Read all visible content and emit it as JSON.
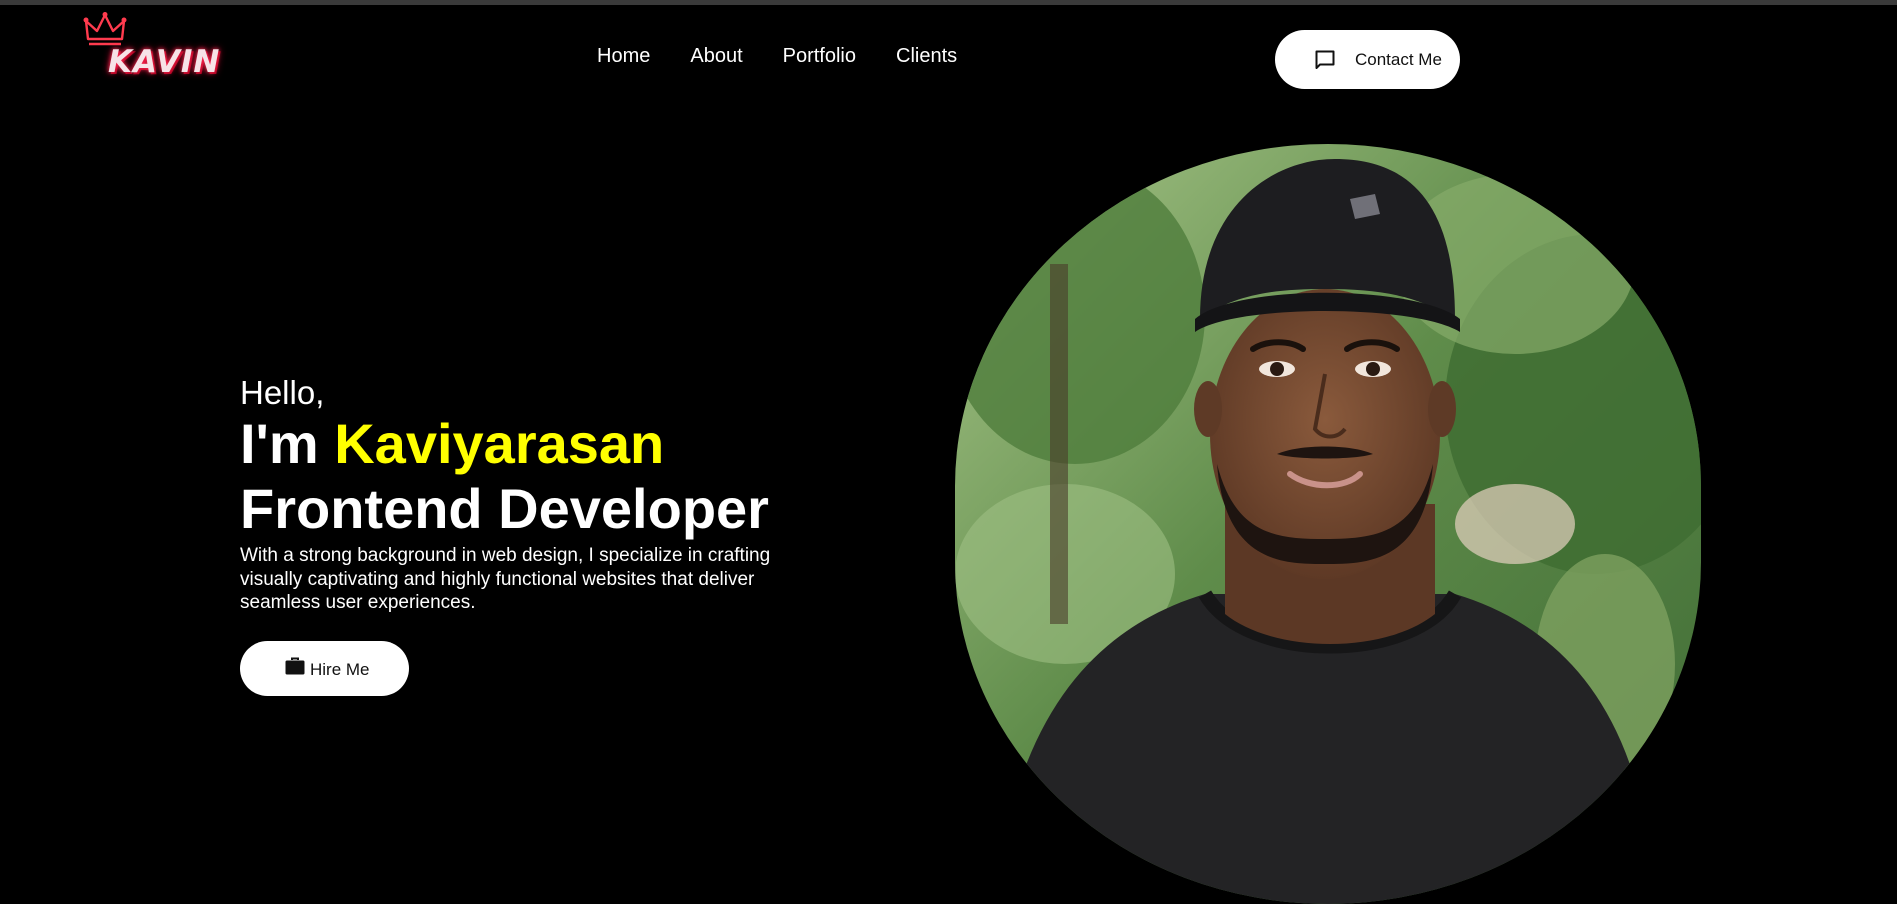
{
  "header": {
    "logo_text": "KAVIN",
    "nav": [
      {
        "label": "Home"
      },
      {
        "label": "About"
      },
      {
        "label": "Portfolio"
      },
      {
        "label": "Clients"
      }
    ],
    "contact_label": "Contact Me"
  },
  "hero": {
    "greeting": "Hello,",
    "name_prefix": "I'm ",
    "name": "Kaviyarasan",
    "role": "Frontend Developer",
    "bio": "With a strong background in web design, I specialize in crafting visually captivating and highly functional websites that deliver seamless user experiences.",
    "hire_label": "Hire Me"
  },
  "colors": {
    "background": "#000000",
    "highlight": "#ffff00",
    "button_bg": "#ffffff",
    "logo_glow": "#ff2d55"
  },
  "icons": {
    "logo": "crown-icon",
    "contact": "message-square-icon",
    "hire": "briefcase-icon"
  }
}
